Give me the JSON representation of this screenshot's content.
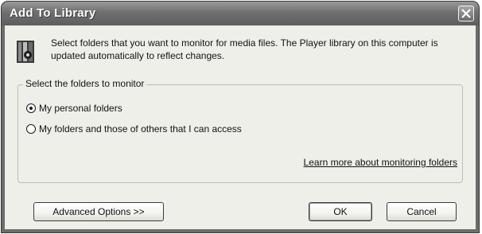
{
  "window": {
    "title": "Add To Library"
  },
  "icons": {
    "close": "close-icon",
    "library": "media-library-icon"
  },
  "info": {
    "text": "Select folders that you want to monitor for media files.  The Player library on this computer is updated automatically to reflect changes."
  },
  "group": {
    "legend": "Select the folders to monitor",
    "options": [
      {
        "label": "My personal folders",
        "selected": true
      },
      {
        "label": "My folders and those of others that I can access",
        "selected": false
      }
    ],
    "link": "Learn more about monitoring folders"
  },
  "buttons": {
    "advanced": "Advanced Options >>",
    "ok": "OK",
    "cancel": "Cancel"
  },
  "colors": {
    "titlebar": "#6f6f6f",
    "client": "#efefea",
    "text": "#111111"
  }
}
